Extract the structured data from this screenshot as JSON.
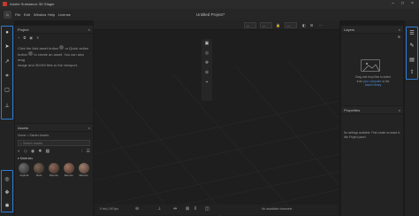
{
  "titlebar": {
    "app_title": "Adobe Substance 3D Stager"
  },
  "menubar": {
    "items": [
      "File",
      "Edit",
      "Window",
      "Help",
      "License"
    ],
    "document_title": "Untitled Project*"
  },
  "scene_panel": {
    "title": "Project",
    "empty_message_1": "Click the Add asset button",
    "empty_message_2": "or Quick action",
    "empty_message_3": "button",
    "empty_message_4": "to create an asset. You can also drag",
    "empty_message_5": "image and 3D/2M files to the viewport."
  },
  "assets_panel": {
    "title": "Assets",
    "breadcrumb_home": "Home",
    "breadcrumb_sep": ">",
    "breadcrumb_current": "Starter Assets",
    "search_placeholder": "Search assets",
    "section_title": "Materials",
    "materials": [
      "Asphalt",
      "Bark",
      "Bauxite",
      "Bauxite",
      "Bauxite"
    ]
  },
  "viewport": {
    "top_dropdown_1": "---",
    "top_dropdown_2": "---",
    "top_dropdown_3": "---",
    "status_text": "0 tris | 0/0 fps",
    "bottom_right_status": "No available channels"
  },
  "layers_panel": {
    "title": "Layers",
    "drop_hint_1": "Drag and drop files to select",
    "drop_hint_2": "from",
    "drop_hint_link_1": "your computer",
    "drop_hint_3": "or the",
    "drop_hint_link_2": "Asset Library"
  },
  "properties_panel": {
    "title": "Properties",
    "empty_message": "No settings available. First create an asset in this Project panel."
  },
  "colors": {
    "accent": "#2f7dd8",
    "bg": "#1b1b1b",
    "panel": "#232323"
  }
}
